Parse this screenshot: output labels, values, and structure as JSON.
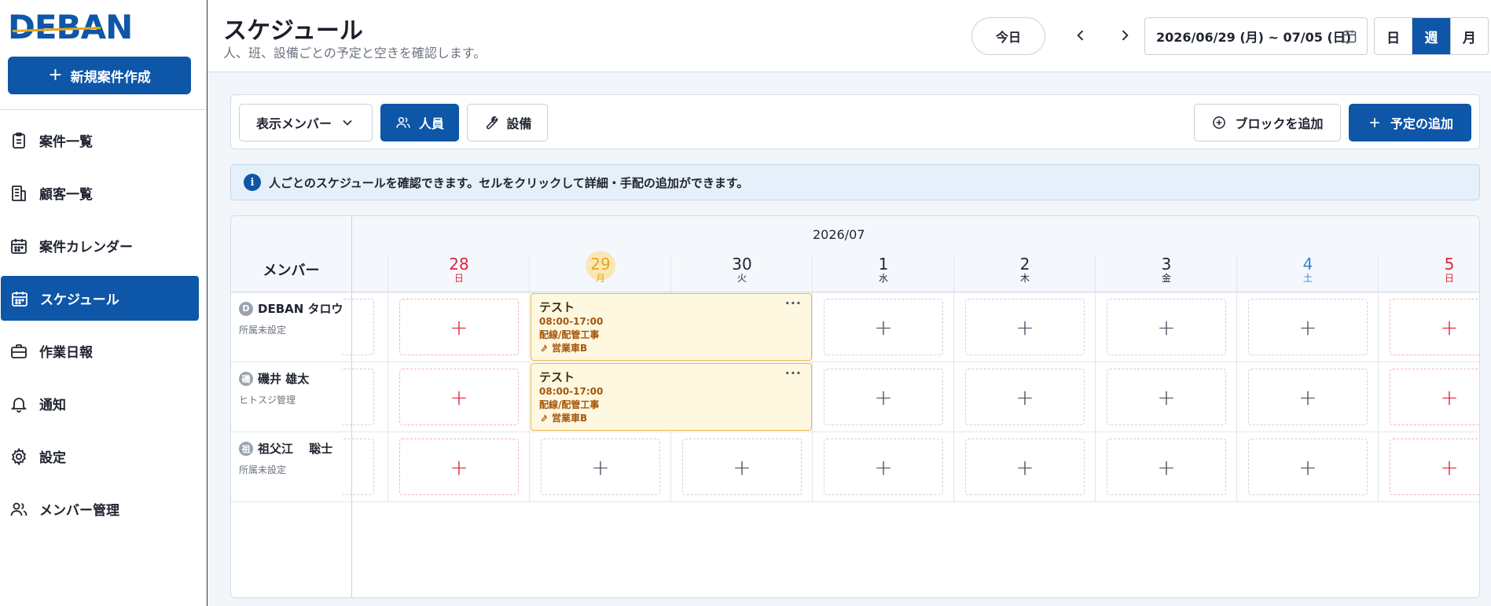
{
  "app": {
    "logo_text": "DEBAN",
    "new_case_label": "新規案件作成"
  },
  "sidebar": {
    "items": [
      {
        "label": "案件一覧",
        "icon": "clipboard-icon",
        "active": false
      },
      {
        "label": "顧客一覧",
        "icon": "building-icon",
        "active": false
      },
      {
        "label": "案件カレンダー",
        "icon": "calendar-icon",
        "active": false
      },
      {
        "label": "スケジュール",
        "icon": "calendar-icon",
        "active": true
      },
      {
        "label": "作業日報",
        "icon": "briefcase-icon",
        "active": false
      },
      {
        "label": "通知",
        "icon": "bell-icon",
        "active": false
      },
      {
        "label": "設定",
        "icon": "gear-icon",
        "active": false
      },
      {
        "label": "メンバー管理",
        "icon": "users-icon",
        "active": false
      }
    ]
  },
  "header": {
    "title": "スケジュール",
    "subtitle": "人、班、設備ごとの予定と空きを確認します。",
    "today_label": "今日",
    "date_range": "2026/06/29 (月) ~ 07/05 (日)",
    "views": [
      "日",
      "週",
      "月"
    ],
    "active_view": "週"
  },
  "toolbar": {
    "member_select": "表示メンバー",
    "tab_people": "人員",
    "tab_equipment": "設備",
    "add_block": "ブロックを追加",
    "add_schedule": "予定の追加"
  },
  "info_text": "人ごとのスケジュールを確認できます。セルをクリックして詳細・手配の追加ができます。",
  "grid": {
    "member_header": "メンバー",
    "month": "2026/07",
    "days": [
      {
        "num": "28",
        "wk": "日",
        "color": "#e0243c"
      },
      {
        "num": "29",
        "wk": "月",
        "color": "#e5a51e",
        "today": true
      },
      {
        "num": "30",
        "wk": "火",
        "color": "#1f2430"
      },
      {
        "num": "1",
        "wk": "水",
        "color": "#1f2430"
      },
      {
        "num": "2",
        "wk": "木",
        "color": "#1f2430"
      },
      {
        "num": "3",
        "wk": "金",
        "color": "#1f2430"
      },
      {
        "num": "4",
        "wk": "土",
        "color": "#3b7fd9"
      },
      {
        "num": "5",
        "wk": "日",
        "color": "#e0243c"
      }
    ],
    "members": [
      {
        "avatar": "D",
        "name": "DEBAN タロウ",
        "dept": "所属未設定"
      },
      {
        "avatar": "磯",
        "name": "磯井 雄太",
        "dept": "ヒトスジ管理"
      },
      {
        "avatar": "祖",
        "name": "祖父江　 聡士",
        "dept": "所属未設定"
      }
    ],
    "events": [
      {
        "title": "テスト",
        "time": "08:00-17:00",
        "type": "配線/配管工事",
        "equipment": "営業車B",
        "menu": "···"
      },
      {
        "title": "テスト",
        "time": "08:00-17:00",
        "type": "配線/配管工事",
        "equipment": "営業車B",
        "menu": "···"
      }
    ],
    "add_symbol": "+"
  }
}
